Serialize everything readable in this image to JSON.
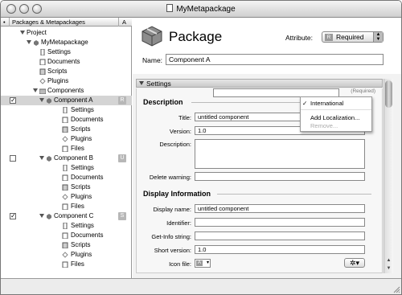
{
  "window": {
    "title": "MyMetapackage"
  },
  "outline": {
    "header": {
      "col_bullet": "•",
      "col_name": "Packages & Metapackages",
      "col_badge": "A"
    },
    "rows": [
      {
        "label": "Project"
      },
      {
        "label": "MyMetapackage"
      },
      {
        "label": "Settings"
      },
      {
        "label": "Documents"
      },
      {
        "label": "Scripts"
      },
      {
        "label": "Plugins"
      },
      {
        "label": "Components"
      },
      {
        "label": "Component A",
        "badge": "R",
        "checked": true
      },
      {
        "label": "Settings"
      },
      {
        "label": "Documents"
      },
      {
        "label": "Scripts"
      },
      {
        "label": "Plugins"
      },
      {
        "label": "Files"
      },
      {
        "label": "Component B",
        "badge": "U",
        "checked": false
      },
      {
        "label": "Settings"
      },
      {
        "label": "Documents"
      },
      {
        "label": "Scripts"
      },
      {
        "label": "Plugins"
      },
      {
        "label": "Files"
      },
      {
        "label": "Component C",
        "badge": "S",
        "checked": true
      },
      {
        "label": "Settings"
      },
      {
        "label": "Documents"
      },
      {
        "label": "Scripts"
      },
      {
        "label": "Plugins"
      },
      {
        "label": "Files"
      }
    ]
  },
  "inspector": {
    "title": "Package",
    "attribute_label": "Attribute:",
    "attribute_value": "Required",
    "attribute_badge": "R",
    "name_label": "Name:",
    "name_value": "Component A",
    "settings_label": "Settings",
    "required_note": "(Required)",
    "description": {
      "heading": "Description",
      "title_label": "Title:",
      "title_value": "untitled component",
      "version_label": "Version:",
      "version_value": "1.0",
      "description_label": "Description:",
      "delete_warning_label": "Delete warning:"
    },
    "display": {
      "heading": "Display Information",
      "display_name_label": "Display name:",
      "display_name_value": "untitled component",
      "identifier_label": "Identifier:",
      "getinfo_label": "Get-Info string:",
      "short_version_label": "Short version:",
      "short_version_value": "1.0",
      "icon_file_label": "Icon file:"
    },
    "menu": {
      "item1": "International",
      "check": "✓",
      "item2": "Add Localization...",
      "item3": "Remove..."
    },
    "gear_glyph": "✲▾"
  }
}
